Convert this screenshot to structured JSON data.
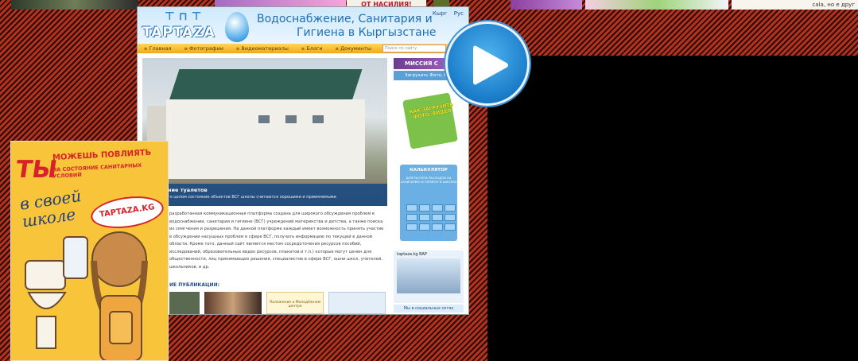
{
  "top_strip": {
    "banner_text": "ОТ НАСИЛИЯ!",
    "right_text": "сala, но е друг"
  },
  "site": {
    "logo": "TAPTAZA",
    "title_line1": "Водоснабжение, Санитария и",
    "title_line2": "Гигиена в Кыргызстане",
    "lang": [
      "Кырг",
      "Рус"
    ],
    "nav": [
      "Главная",
      "Фотографии",
      "Видеоматериалы",
      "Блоги",
      "Документы"
    ],
    "search_placeholder": "Поиск по сайту",
    "hero_caption_title": "ние туалетов",
    "hero_caption_sub": "го целом состояние объектов ВСГ школы считаются хорошими и приемлемыми",
    "body_text": "разработанная коммуникационная платформа создана для широкого обсуждения проблем в водоснабжении, санитарии и гигиене (ВСГ) учреждений материнства и детства, а также поиска их смягчения и разрешения. На данной платформе каждый имеет возможность принять участие в обсуждении насущных проблем в сфере ВСГ, получать информацию по текущей в данной области. Кроме того, данный сайт является местом сосредоточения ресурсов пособий, исследований, образовательных видео ресурсов, плакатов и т.п.) которые могут ценен для общественности, лиц принимающих решения, специалистов в сфере ВСГ, ошни школ, учителей, школьников, и др.",
    "publications_title": "ИЕ ПУБЛИКАЦИИ:",
    "pub_label": "Положение о Молодёжном центре",
    "sidebar": {
      "mission": "МИССИЯ С",
      "upload": "Загрузить Фото, Ви",
      "sticker": "КАК ЗАГРУЗИТЬ ФОТО, ВИДЕО",
      "calc_title": "КАЛЬКУЛЯТОР",
      "calc_sub": "ДЛЯ РАСЧЕТА РАСХОДОВ НА САНИТАРИЮ И ГИГИЕНУ В ШКОЛАХ",
      "video_title": "taptaza.kg RAP",
      "video_social": "Мы в социальных сетях"
    }
  },
  "poster": {
    "big_word": "ТЫ",
    "line1": "МОЖЕШЬ ПОВЛИЯТЬ",
    "line2": "НА СОСТОЯНИЕ САНИТАРНЫХ УСЛОВИЙ",
    "script": "в своей школе",
    "brand": "TAPTAZA.KG"
  },
  "colors": {
    "background_stripe_dark": "#2a0c07",
    "background_stripe_red": "#b3321f",
    "play_button": "#1a7cc9",
    "video_area": "#000000"
  },
  "icons": {
    "play": "play-icon"
  }
}
